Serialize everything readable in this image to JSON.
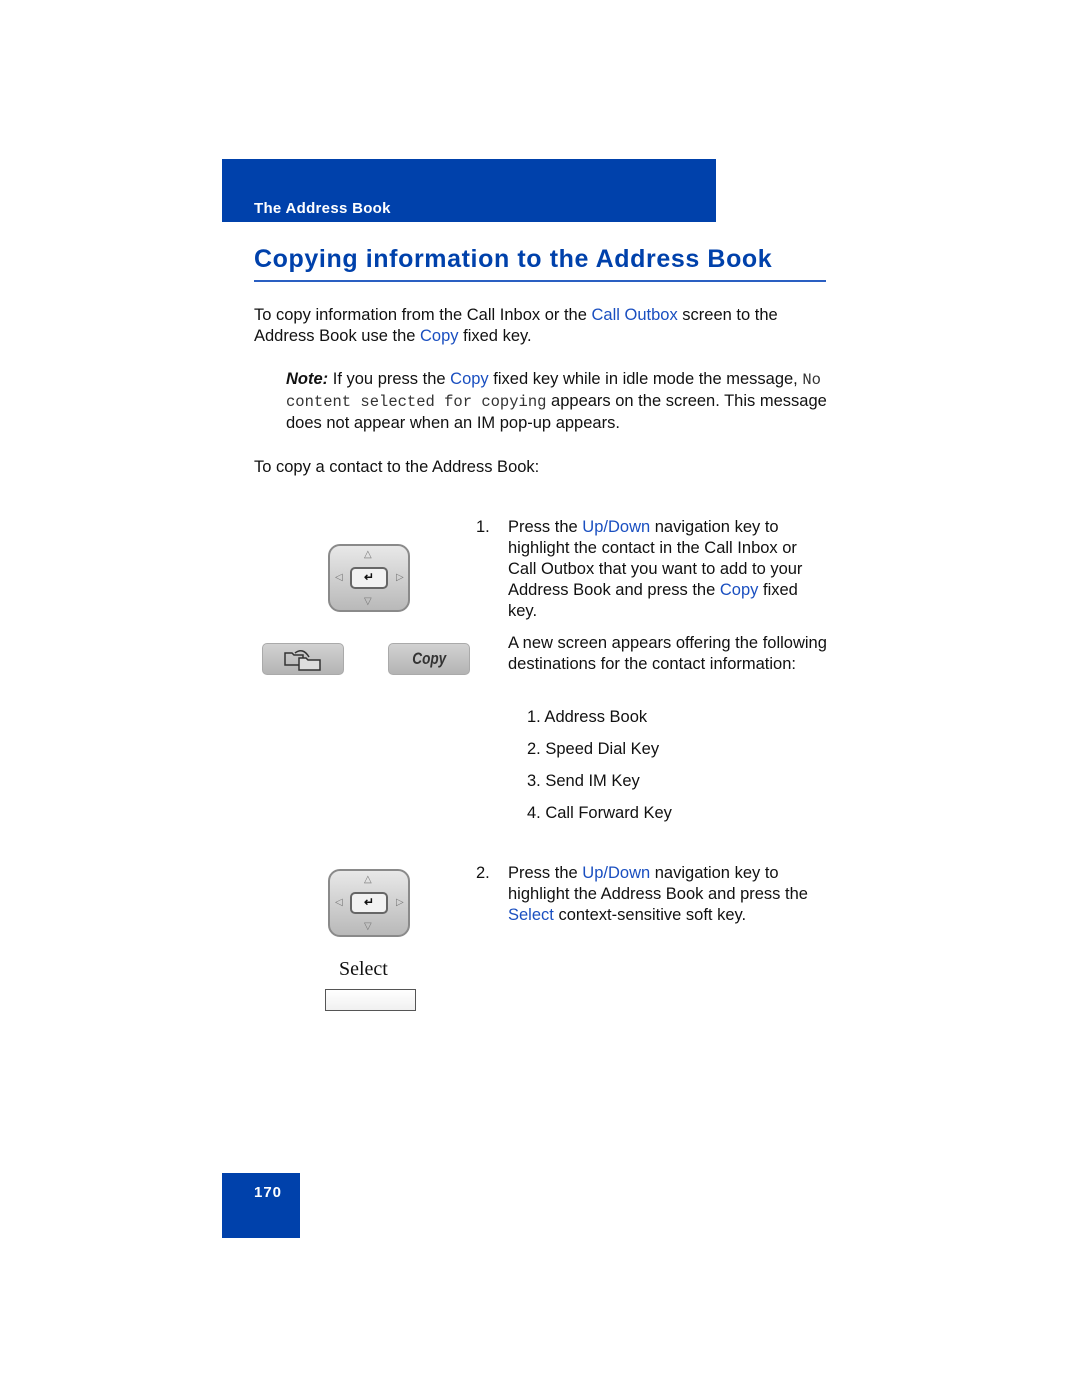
{
  "header": {
    "section": "The Address Book"
  },
  "title": "Copying information to the Address Book",
  "intro": {
    "t1": "To copy information from the Call Inbox or the ",
    "link1": "Call Outbox",
    "t2": "  screen to the Address Book use the ",
    "link2": "Copy",
    "t3": "  fixed key."
  },
  "note": {
    "label": "Note:",
    "t1": "  If you press the ",
    "link": "Copy",
    "t2": "  fixed key while in idle mode the message, ",
    "code": "No content selected for copying",
    "t3": " appears on the screen. This message does not appear when an IM pop-up appears."
  },
  "lead": "To copy a contact to the Address Book:",
  "steps": [
    {
      "num": "1.",
      "t1": "Press the ",
      "link1": "Up/Down",
      "t2": "  navigation key to highlight the contact in the Call Inbox or Call Outbox that you want to add to your Address Book and press the ",
      "link2": "Copy",
      "t3": "  fixed key."
    },
    {
      "num": "2.",
      "t1": "Press the ",
      "link1": "Up/Down",
      "t2": "  navigation key to highlight the Address Book and press the ",
      "link2": "Select",
      "t3": "  context-sensitive soft key."
    }
  ],
  "after_step1": "A new screen appears offering the following destinations for the contact information:",
  "destinations": [
    "1. Address Book",
    "2. Speed Dial Key",
    "3. Send IM Key",
    "4. Call Forward Key"
  ],
  "images": {
    "copy_key_label": "Copy",
    "select_softkey_label": "Select",
    "enter_glyph": "↵"
  },
  "page_number": "170"
}
